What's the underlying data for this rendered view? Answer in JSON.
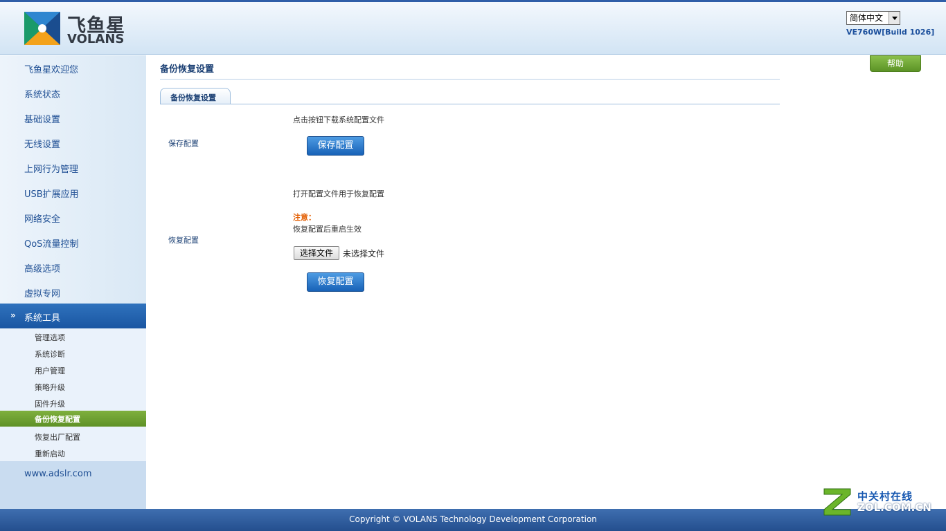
{
  "header": {
    "logo_cn": "飞鱼星",
    "logo_en": "VOLANS",
    "language": "简体中文",
    "version": "VE760W[Build 1026]"
  },
  "sidebar": {
    "items": [
      {
        "label": "飞鱼星欢迎您"
      },
      {
        "label": "系统状态"
      },
      {
        "label": "基础设置"
      },
      {
        "label": "无线设置"
      },
      {
        "label": "上网行为管理"
      },
      {
        "label": "USB扩展应用"
      },
      {
        "label": "网络安全"
      },
      {
        "label": "QoS流量控制"
      },
      {
        "label": "高级选项"
      },
      {
        "label": "虚拟专网"
      }
    ],
    "active": {
      "label": "系统工具"
    },
    "subitems": [
      {
        "label": "管理选项"
      },
      {
        "label": "系统诊断"
      },
      {
        "label": "用户管理"
      },
      {
        "label": "策略升级"
      },
      {
        "label": "固件升级"
      },
      {
        "label": "备份恢复配置"
      },
      {
        "label": "恢复出厂配置"
      },
      {
        "label": "重新启动"
      }
    ],
    "site_link": "www.adslr.com"
  },
  "main": {
    "title": "备份恢复设置",
    "tab": "备份恢复设置",
    "save": {
      "label": "保存配置",
      "hint": "点击按钮下载系统配置文件",
      "button": "保存配置"
    },
    "restore": {
      "label": "恢复配置",
      "hint": "打开配置文件用于恢复配置",
      "note_title": "注意：",
      "note_text": "恢复配置后重启生效",
      "choose_file": "选择文件",
      "file_status": "未选择文件",
      "button": "恢复配置"
    }
  },
  "help": "帮助",
  "footer": "Copyright © VOLANS Technology Development Corporation",
  "watermark": {
    "cn": "中关村在线",
    "en": "ZOL.COM.CN"
  },
  "colors": {
    "brand_blue": "#1f4f94",
    "active_nav": "#1a56a2",
    "selected_sub": "#6ea135",
    "warning": "#e35d00"
  }
}
